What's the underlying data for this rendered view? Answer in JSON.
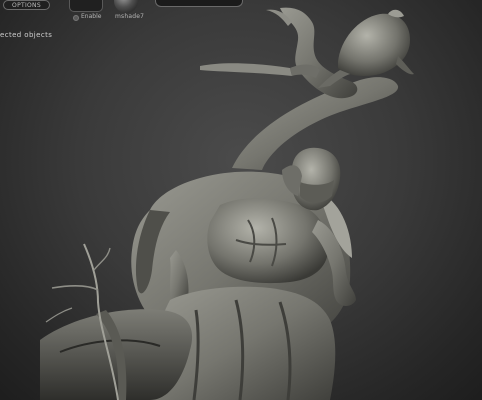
{
  "toolbar": {
    "options_label": "OPTIONS",
    "enable_label": "Enable",
    "material_label": "mshade7"
  },
  "status": {
    "message": "ected objects"
  },
  "colors": {
    "background": "#3a3a3a",
    "model": "#7a7a73",
    "panel": "#202020"
  },
  "icons": {
    "enable": "radio-dot-icon",
    "material": "material-sphere-icon"
  }
}
